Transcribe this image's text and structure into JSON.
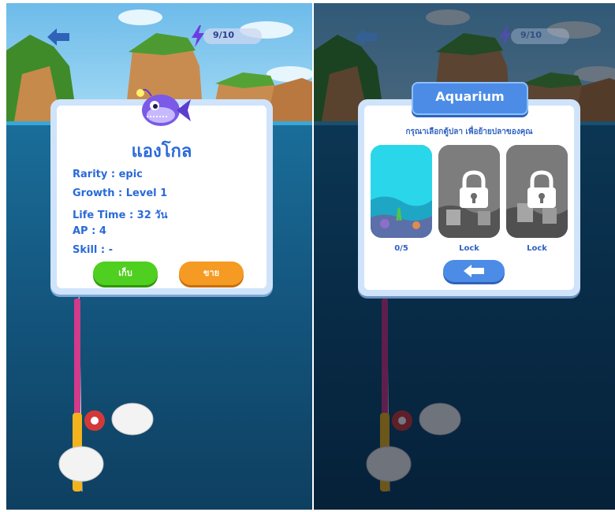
{
  "hud": {
    "energy": "9/10"
  },
  "catch_dialog": {
    "fish_name": "แองโกล",
    "stats": [
      "Rarity : epic",
      "Growth : Level 1",
      "Life Time : 32 วัน",
      "AP : 4",
      "Skill : -"
    ],
    "keep_label": "เก็บ",
    "sell_label": "ขาย"
  },
  "aquarium_dialog": {
    "title": "Aquarium",
    "prompt": "กรุณาเลือกตู้ปลา เพื่อย้ายปลาของคุณ",
    "tanks": [
      {
        "label": "0/5",
        "locked": false
      },
      {
        "label": "Lock",
        "locked": true
      },
      {
        "label": "Lock",
        "locked": true
      }
    ]
  },
  "colors": {
    "sky": "#7cc6ee",
    "sea": "#135a83",
    "dialog_text": "#2a6ad8",
    "keep": "#4fcf1f",
    "sell": "#f59a22",
    "banner": "#4c8ce6"
  },
  "icons": [
    "back-arrow-icon",
    "lightning-bolt-icon",
    "lock-icon",
    "anglerfish-icon",
    "fishing-rod-icon",
    "glove-hand-icon"
  ]
}
